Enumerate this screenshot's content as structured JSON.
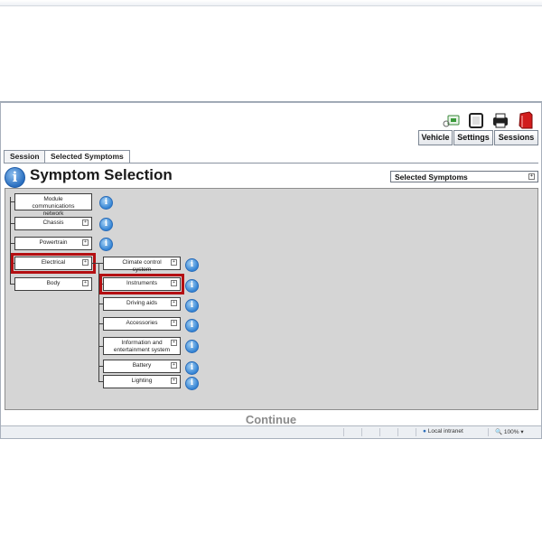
{
  "toolbar": {
    "icons": [
      "vehicle-connect-icon",
      "ecu-icon",
      "printer-icon",
      "red-book-icon"
    ],
    "tabs": [
      "Vehicle",
      "Settings",
      "Sessions"
    ]
  },
  "session_tabs": [
    "Session",
    "Selected Symptoms"
  ],
  "header": {
    "title": "Symptom Selection",
    "select_value": "Selected Symptoms",
    "expander": "+"
  },
  "tree": {
    "level1": [
      "Module communications network",
      "Chassis",
      "Powertrain",
      "Electrical",
      "Body"
    ],
    "level2": [
      "Climate control system",
      "Instruments",
      "Driving aids",
      "Accessories",
      "Information and entertainment system",
      "Battery",
      "Lighting"
    ],
    "info_glyph": "i",
    "expander": "+"
  },
  "continue_label": "Continue",
  "status": {
    "zone": "Local intranet",
    "zoom": "100%"
  },
  "colors": {
    "selection_outline": "#b40f12",
    "panel_bg": "#d5d5d5",
    "info_blue": "#3484d4"
  }
}
